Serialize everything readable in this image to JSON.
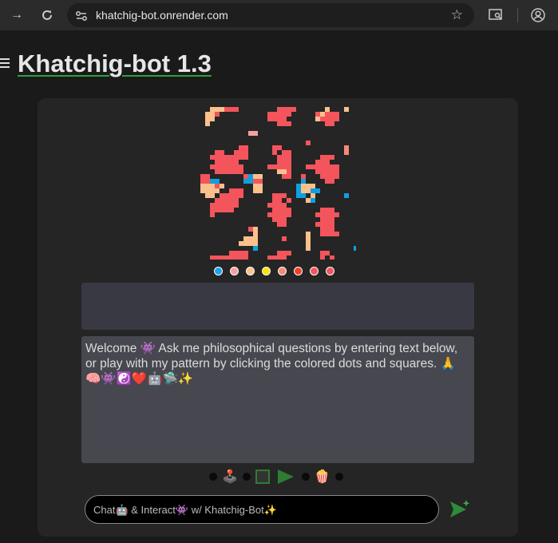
{
  "browser": {
    "url": "khatchig-bot.onrender.com",
    "icons": [
      "forward-arrow-icon",
      "reload-icon",
      "site-settings-icon",
      "bookmark-star-icon",
      "install-app-icon",
      "profile-icon"
    ]
  },
  "page": {
    "title": "Khatchig-bot 1.3"
  },
  "pattern": {
    "colors": {
      "coral": "#f4545c",
      "peach": "#fbc08c",
      "blue": "#0ea0e0",
      "pink": "#f7a0a0",
      "salmon": "#f58a78"
    },
    "cells": [
      [
        0,
        0,
        0,
        0,
        0,
        0,
        0,
        0,
        0,
        0,
        0,
        0,
        0,
        0,
        0,
        0,
        0,
        0,
        0,
        0,
        0,
        0,
        0,
        0,
        0,
        0,
        0,
        0,
        0,
        0,
        0,
        0,
        0
      ],
      [
        0,
        0,
        2,
        2,
        2,
        1,
        1,
        1,
        0,
        0,
        0,
        0,
        0,
        0,
        0,
        0,
        1,
        1,
        1,
        1,
        0,
        0,
        0,
        0,
        0,
        0,
        2,
        0,
        0,
        0,
        2,
        0,
        0
      ],
      [
        0,
        2,
        2,
        1,
        0,
        0,
        0,
        0,
        0,
        0,
        0,
        0,
        0,
        0,
        1,
        1,
        1,
        1,
        1,
        0,
        0,
        0,
        0,
        0,
        1,
        2,
        1,
        1,
        1,
        0,
        0,
        0,
        0
      ],
      [
        0,
        2,
        2,
        0,
        0,
        0,
        0,
        0,
        0,
        0,
        0,
        0,
        0,
        0,
        1,
        1,
        1,
        1,
        0,
        0,
        0,
        0,
        0,
        0,
        2,
        1,
        1,
        1,
        1,
        0,
        0,
        0,
        0
      ],
      [
        0,
        2,
        0,
        0,
        0,
        0,
        0,
        0,
        0,
        0,
        0,
        0,
        0,
        0,
        0,
        0,
        1,
        1,
        1,
        0,
        0,
        0,
        0,
        0,
        0,
        0,
        1,
        1,
        0,
        0,
        0,
        0,
        0
      ],
      [
        0,
        0,
        0,
        0,
        0,
        0,
        0,
        0,
        0,
        0,
        0,
        0,
        0,
        0,
        0,
        0,
        0,
        0,
        0,
        0,
        0,
        0,
        0,
        0,
        0,
        0,
        0,
        0,
        0,
        0,
        0,
        0,
        0
      ],
      [
        0,
        0,
        0,
        0,
        0,
        0,
        0,
        0,
        0,
        0,
        4,
        4,
        0,
        0,
        0,
        0,
        0,
        0,
        0,
        0,
        0,
        0,
        0,
        0,
        0,
        0,
        0,
        0,
        0,
        0,
        0,
        0,
        0
      ],
      [
        0,
        0,
        0,
        0,
        0,
        0,
        0,
        0,
        0,
        0,
        0,
        0,
        0,
        0,
        0,
        0,
        0,
        0,
        0,
        0,
        0,
        0,
        0,
        0,
        0,
        0,
        0,
        0,
        0,
        0,
        0,
        0,
        0
      ],
      [
        0,
        0,
        0,
        0,
        0,
        0,
        0,
        0,
        0,
        0,
        0,
        0,
        0,
        0,
        0,
        0,
        0,
        0,
        0,
        0,
        0,
        0,
        1,
        0,
        0,
        0,
        0,
        0,
        0,
        0,
        0,
        0,
        0
      ],
      [
        0,
        0,
        0,
        0,
        0,
        0,
        0,
        0,
        1,
        1,
        0,
        0,
        0,
        0,
        0,
        1,
        1,
        0,
        0,
        0,
        0,
        0,
        0,
        0,
        0,
        0,
        0,
        0,
        0,
        0,
        5,
        0,
        0
      ],
      [
        0,
        0,
        0,
        1,
        1,
        0,
        0,
        1,
        1,
        1,
        0,
        0,
        0,
        0,
        0,
        1,
        0,
        1,
        1,
        0,
        0,
        0,
        0,
        0,
        0,
        0,
        0,
        0,
        0,
        0,
        5,
        0,
        0
      ],
      [
        0,
        0,
        1,
        1,
        1,
        1,
        1,
        1,
        1,
        1,
        0,
        0,
        0,
        0,
        0,
        0,
        1,
        1,
        1,
        0,
        0,
        0,
        0,
        0,
        0,
        1,
        1,
        1,
        0,
        0,
        0,
        0,
        0
      ],
      [
        0,
        0,
        0,
        1,
        1,
        1,
        1,
        1,
        0,
        0,
        0,
        0,
        0,
        0,
        0,
        0,
        1,
        1,
        1,
        0,
        0,
        0,
        0,
        0,
        1,
        1,
        1,
        0,
        0,
        0,
        0,
        0,
        0
      ],
      [
        0,
        0,
        1,
        1,
        1,
        1,
        1,
        1,
        1,
        0,
        0,
        0,
        0,
        0,
        1,
        1,
        1,
        1,
        1,
        0,
        0,
        0,
        1,
        1,
        1,
        1,
        1,
        1,
        1,
        0,
        0,
        0,
        0
      ],
      [
        0,
        0,
        0,
        1,
        1,
        1,
        1,
        1,
        1,
        0,
        0,
        0,
        0,
        0,
        0,
        0,
        2,
        2,
        1,
        0,
        0,
        0,
        0,
        0,
        1,
        1,
        1,
        1,
        1,
        0,
        0,
        0,
        0
      ],
      [
        1,
        1,
        0,
        0,
        0,
        0,
        0,
        0,
        0,
        1,
        3,
        2,
        2,
        0,
        0,
        0,
        0,
        1,
        1,
        0,
        0,
        1,
        0,
        0,
        0,
        1,
        1,
        1,
        1,
        0,
        0,
        0,
        0
      ],
      [
        1,
        1,
        3,
        3,
        0,
        0,
        0,
        0,
        0,
        3,
        3,
        1,
        1,
        0,
        0,
        0,
        0,
        0,
        0,
        0,
        0,
        3,
        0,
        0,
        0,
        0,
        1,
        1,
        0,
        0,
        0,
        0,
        0
      ],
      [
        2,
        2,
        2,
        1,
        2,
        0,
        0,
        0,
        0,
        0,
        0,
        2,
        2,
        0,
        0,
        0,
        0,
        0,
        0,
        0,
        3,
        2,
        2,
        2,
        0,
        0,
        0,
        0,
        0,
        0,
        0,
        0,
        0
      ],
      [
        2,
        2,
        2,
        2,
        0,
        0,
        1,
        1,
        1,
        0,
        0,
        2,
        2,
        0,
        0,
        0,
        0,
        0,
        0,
        0,
        3,
        2,
        2,
        3,
        3,
        0,
        0,
        0,
        0,
        0,
        0,
        0,
        0
      ],
      [
        0,
        2,
        2,
        0,
        1,
        1,
        1,
        1,
        1,
        0,
        0,
        0,
        0,
        0,
        0,
        1,
        1,
        1,
        0,
        0,
        3,
        3,
        0,
        2,
        0,
        0,
        0,
        0,
        0,
        0,
        3,
        0,
        0
      ],
      [
        0,
        0,
        0,
        1,
        1,
        1,
        1,
        1,
        0,
        0,
        0,
        0,
        0,
        0,
        0,
        1,
        1,
        0,
        1,
        0,
        0,
        0,
        2,
        3,
        0,
        0,
        0,
        0,
        0,
        0,
        0,
        0,
        0
      ],
      [
        0,
        0,
        1,
        1,
        1,
        1,
        1,
        1,
        0,
        0,
        0,
        0,
        0,
        0,
        1,
        1,
        1,
        1,
        0,
        0,
        0,
        0,
        0,
        0,
        0,
        0,
        0,
        0,
        0,
        0,
        0,
        0,
        0
      ],
      [
        0,
        0,
        1,
        1,
        1,
        1,
        1,
        0,
        0,
        0,
        0,
        0,
        0,
        0,
        0,
        1,
        1,
        1,
        1,
        0,
        0,
        0,
        0,
        0,
        0,
        1,
        1,
        1,
        0,
        0,
        0,
        0,
        0
      ],
      [
        0,
        0,
        1,
        0,
        0,
        0,
        0,
        0,
        0,
        0,
        0,
        0,
        0,
        0,
        1,
        1,
        1,
        1,
        1,
        0,
        0,
        0,
        0,
        0,
        1,
        1,
        1,
        1,
        1,
        0,
        0,
        0,
        0
      ],
      [
        0,
        0,
        0,
        0,
        0,
        0,
        0,
        0,
        0,
        0,
        0,
        0,
        0,
        0,
        0,
        1,
        1,
        1,
        0,
        0,
        0,
        0,
        0,
        0,
        0,
        1,
        1,
        1,
        0,
        0,
        0,
        0,
        0
      ],
      [
        0,
        0,
        0,
        0,
        0,
        0,
        0,
        0,
        0,
        0,
        0,
        0,
        0,
        0,
        0,
        0,
        1,
        1,
        0,
        0,
        0,
        0,
        0,
        0,
        1,
        1,
        1,
        1,
        0,
        0,
        0,
        0,
        0
      ],
      [
        0,
        0,
        0,
        0,
        0,
        0,
        0,
        0,
        0,
        0,
        1,
        2,
        0,
        0,
        0,
        0,
        0,
        0,
        0,
        0,
        0,
        0,
        0,
        0,
        0,
        1,
        1,
        1,
        0,
        0,
        0,
        0,
        0
      ],
      [
        0,
        0,
        0,
        0,
        0,
        0,
        0,
        0,
        0,
        0,
        0,
        2,
        0,
        0,
        0,
        0,
        0,
        0,
        0,
        0,
        0,
        0,
        2,
        0,
        0,
        1,
        1,
        1,
        1,
        0,
        0,
        0,
        0
      ],
      [
        0,
        0,
        0,
        0,
        0,
        0,
        0,
        0,
        0,
        2,
        2,
        2,
        0,
        0,
        0,
        0,
        0,
        1,
        0,
        0,
        0,
        0,
        2,
        0,
        0,
        0,
        0,
        0,
        0,
        0,
        0,
        0,
        0
      ],
      [
        0,
        0,
        0,
        0,
        0,
        0,
        0,
        0,
        2,
        2,
        2,
        2,
        0,
        0,
        0,
        0,
        0,
        0,
        0,
        0,
        0,
        0,
        2,
        0,
        0,
        0,
        0,
        0,
        0,
        0,
        0,
        0,
        0
      ],
      [
        0,
        0,
        0,
        0,
        0,
        0,
        0,
        0,
        0,
        0,
        0,
        3,
        0,
        0,
        0,
        0,
        0,
        0,
        0,
        0,
        0,
        0,
        2,
        0,
        0,
        0,
        0,
        0,
        0,
        0,
        0,
        0,
        3
      ],
      [
        0,
        0,
        0,
        0,
        0,
        0,
        1,
        1,
        1,
        1,
        0,
        0,
        0,
        0,
        0,
        0,
        1,
        1,
        1,
        0,
        0,
        0,
        0,
        0,
        0,
        1,
        1,
        0,
        0,
        0,
        0,
        0,
        0
      ],
      [
        0,
        0,
        1,
        1,
        1,
        1,
        1,
        1,
        1,
        1,
        0,
        0,
        0,
        0,
        1,
        1,
        1,
        1,
        0,
        0,
        0,
        0,
        0,
        0,
        0,
        1,
        0,
        1,
        0,
        0,
        0,
        0,
        0
      ],
      [
        0,
        0,
        0,
        0,
        0,
        0,
        0,
        0,
        0,
        0,
        0,
        0,
        0,
        0,
        0,
        0,
        0,
        0,
        0,
        0,
        0,
        0,
        0,
        0,
        0,
        0,
        0,
        0,
        0,
        0,
        0,
        0,
        0
      ]
    ],
    "palette_dots": [
      {
        "color": "#1ea4e6"
      },
      {
        "color": "#f7a0a0"
      },
      {
        "color": "#fbc08c"
      },
      {
        "color": "#ffe000"
      },
      {
        "color": "#f58a78"
      },
      {
        "color": "#f0402a"
      },
      {
        "color": "#f4545c"
      },
      {
        "color": "#f4545c"
      }
    ]
  },
  "welcome_message": "Welcome 👾 Ask me philosophical questions by entering text below, or play with my pattern by clicking the colored dots and squares. 🙏 🧠👾☯️❤️🤖🛸✨",
  "controls": {
    "joystick_emoji": "🕹️",
    "popcorn_emoji": "🍿"
  },
  "chat": {
    "placeholder": "Chat🤖 & Interact👾 w/ Khatchig-Bot✨"
  }
}
